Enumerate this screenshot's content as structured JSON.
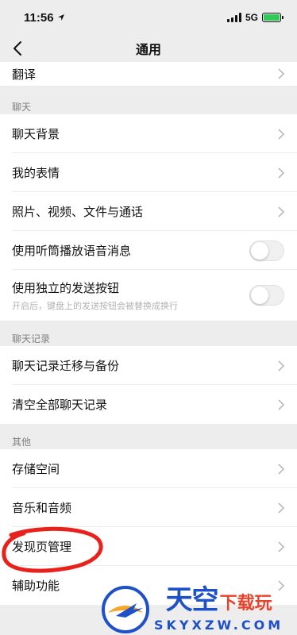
{
  "status_bar": {
    "time": "11:56",
    "network": "5G"
  },
  "nav": {
    "title": "通用"
  },
  "rows": {
    "translate": "翻译",
    "chat_background": "聊天背景",
    "my_stickers": "我的表情",
    "media_files": "照片、视频、文件与通话",
    "earpiece": "使用听筒播放语音消息",
    "send_button": "使用独立的发送按钮",
    "send_button_sub": "开启后，键盘上的发送按钮会被替换成换行",
    "migrate_backup": "聊天记录迁移与备份",
    "clear_history": "清空全部聊天记录",
    "storage": "存储空间",
    "music_audio": "音乐和音频",
    "discover_mgmt": "发现页管理",
    "accessibility": "辅助功能"
  },
  "sections": {
    "chat": "聊天",
    "chat_history": "聊天记录",
    "other": "其他"
  },
  "toggles": {
    "earpiece_on": false,
    "send_button_on": false
  },
  "watermark": {
    "title_big": "天空",
    "title_small": "下载玩",
    "domain": "SKYXZW.COM"
  },
  "colors": {
    "accent_blue": "#1e50c8",
    "accent_red": "#e9422a",
    "highlight_circle": "#e8211a"
  }
}
